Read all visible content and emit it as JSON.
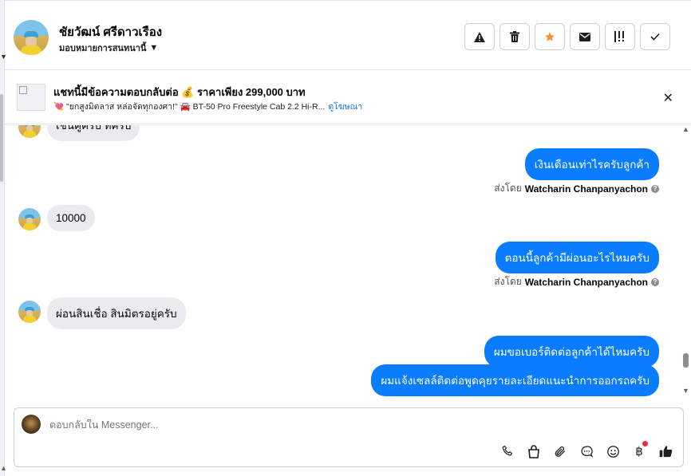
{
  "header": {
    "contact_name": "ชัยวัฒน์ ศรีดาวเรือง",
    "assign_label": "มอบหมายการสนทนานี้",
    "toolbar": [
      {
        "name": "report-spam-button",
        "icon": "warning-icon"
      },
      {
        "name": "delete-button",
        "icon": "trash-icon"
      },
      {
        "name": "star-button",
        "icon": "star-icon"
      },
      {
        "name": "mark-unread-button",
        "icon": "envelope-icon"
      },
      {
        "name": "follow-up-button",
        "icon": "flag-priority-icon"
      },
      {
        "name": "mark-done-button",
        "icon": "check-icon"
      }
    ],
    "star_color": "#f0932b"
  },
  "ad": {
    "title": "แชทนี้มีข้อความตอบกลับต่อ 💰 ราคาเพียง 299,000 บาท",
    "subtitle": "💘 \"ยกสูงมิตลาส หล่อจัดทุกองศา!\" 🚘 BT-50 Pro Freestyle Cab 2.2 Hi-R...",
    "link": "ดูโฆษณา"
  },
  "messages": {
    "partial_top": "เช่นคู่ครับ ที่ครับ",
    "out1": "เงินเดือนเท่าไรครับลูกค้า",
    "sent_by_prefix": "ส่งโดย",
    "sender": "Watcharin Chanpanyachon",
    "in1": "10000",
    "out2": "ตอนนี้ลูกค้ามีผ่อนอะไรไหมครับ",
    "in2": "ผ่อนสินเชื่อ สินมิตรอยู่ครับ",
    "out3": "ผมขอเบอร์ติดต่อลูกค้าได้ไหมครับ",
    "out4": "ผมแจ้งเซลล์ติดต่อพูดคุยรายละเอียดแนะนำการออกรถครับ"
  },
  "composer": {
    "placeholder": "ตอบกลับใน Messenger...",
    "icons": [
      "phone-icon",
      "shopping-bag-icon",
      "paperclip-icon",
      "saved-reply-icon",
      "emoji-icon",
      "baht-payment-icon",
      "thumbs-up-icon"
    ]
  },
  "colors": {
    "outgoing_bubble": "#0a7cff",
    "incoming_bubble": "#e9ebee",
    "link": "#1877f2",
    "notification_dot": "#f02849"
  }
}
